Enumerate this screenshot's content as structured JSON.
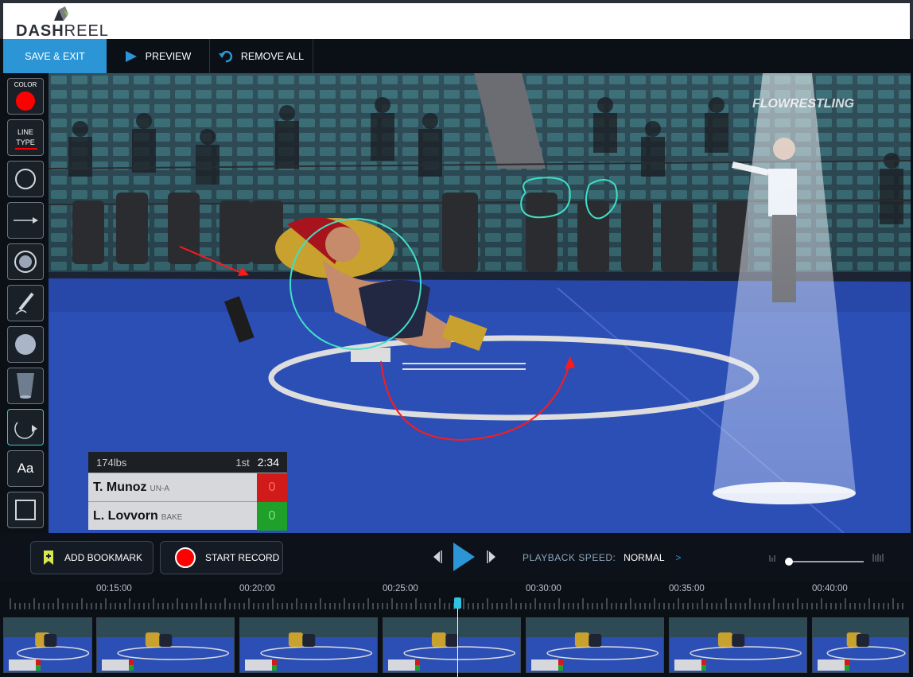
{
  "app": {
    "logo_bold": "DASH",
    "logo_light": "REEL"
  },
  "toolbar": {
    "save_label": "SAVE & EXIT",
    "preview_label": "PREVIEW",
    "remove_label": "REMOVE ALL"
  },
  "tools": {
    "color_label": "COLOR",
    "color_value": "#ff0000",
    "line_label_1": "LINE",
    "line_label_2": "TYPE",
    "text_label": "Aa",
    "items": [
      "color",
      "line-type",
      "circle",
      "arrow",
      "spotlight",
      "pencil",
      "filled-circle",
      "cone",
      "curved-arrow",
      "text",
      "rectangle"
    ],
    "active": "curved-arrow"
  },
  "video": {
    "watermark": "FLOWRESTLING",
    "scoreboard": {
      "weight": "174lbs",
      "period": "1st",
      "clock": "2:34",
      "wrestlers": [
        {
          "name": "T. Munoz",
          "team": "UN-A",
          "score": "0",
          "color": "#e02020"
        },
        {
          "name": "L. Lovvorn",
          "team": "BAKE",
          "score": "0",
          "color": "#1fa02a"
        }
      ]
    },
    "annotation_colors": {
      "red": "#ff1a1a",
      "teal": "#3fe0c8"
    }
  },
  "controls": {
    "bookmark_label": "ADD BOOKMARK",
    "record_label": "START RECORD",
    "speed_label": "PLAYBACK SPEED:",
    "speed_value": "NORMAL",
    "speed_chevron": ">"
  },
  "timeline": {
    "labels": [
      "00:15:00",
      "00:20:00",
      "00:25:00",
      "00:30:00",
      "00:35:00",
      "00:40:00"
    ],
    "accent": "#2ec3e0"
  }
}
